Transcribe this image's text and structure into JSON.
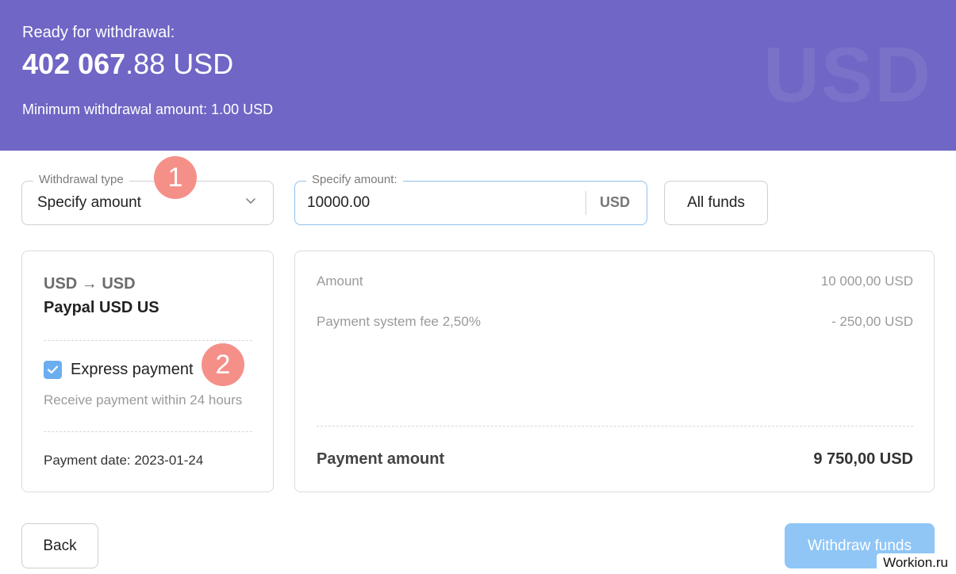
{
  "header": {
    "ready_label": "Ready for withdrawal:",
    "balance_bold": "402 067",
    "balance_rest": ".88 USD",
    "min_text": "Minimum withdrawal amount: 1.00 USD",
    "watermark": "USD",
    "background_color": "#6f66c5"
  },
  "form": {
    "withdrawal_type_legend": "Withdrawal type",
    "withdrawal_type_value": "Specify amount",
    "amount_legend": "Specify amount:",
    "amount_value": "10000.00",
    "amount_currency": "USD",
    "all_funds_label": "All funds"
  },
  "badges": {
    "first": "1",
    "second": "2",
    "color": "#f59089"
  },
  "method": {
    "conversion": "USD → USD",
    "name": "Paypal USD US",
    "express_label": "Express payment",
    "express_checked": true,
    "receive_note": "Receive payment within 24 hours",
    "payment_date": "Payment date: 2023-01-24"
  },
  "summary": {
    "amount_label": "Amount",
    "amount_value": "10 000,00 USD",
    "fee_label": "Payment system fee 2,50%",
    "fee_value": "- 250,00 USD",
    "total_label": "Payment amount",
    "total_value": "9 750,00 USD"
  },
  "actions": {
    "back_label": "Back",
    "withdraw_label": "Withdraw funds",
    "withdraw_color": "#8fc6f6"
  },
  "site_watermark": "Workion.ru",
  "icons": {
    "dropdown": "chevron-down-icon",
    "checkbox": "checkmark-icon"
  }
}
